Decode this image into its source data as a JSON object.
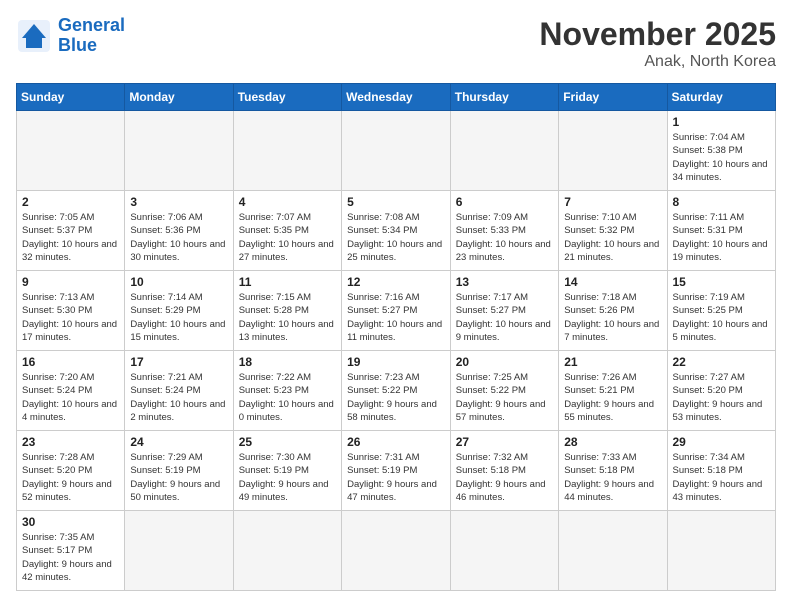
{
  "header": {
    "logo_general": "General",
    "logo_blue": "Blue",
    "month_year": "November 2025",
    "location": "Anak, North Korea"
  },
  "weekdays": [
    "Sunday",
    "Monday",
    "Tuesday",
    "Wednesday",
    "Thursday",
    "Friday",
    "Saturday"
  ],
  "days": {
    "d1": {
      "num": "1",
      "sunrise": "7:04 AM",
      "sunset": "5:38 PM",
      "daylight": "10 hours and 34 minutes."
    },
    "d2": {
      "num": "2",
      "sunrise": "7:05 AM",
      "sunset": "5:37 PM",
      "daylight": "10 hours and 32 minutes."
    },
    "d3": {
      "num": "3",
      "sunrise": "7:06 AM",
      "sunset": "5:36 PM",
      "daylight": "10 hours and 30 minutes."
    },
    "d4": {
      "num": "4",
      "sunrise": "7:07 AM",
      "sunset": "5:35 PM",
      "daylight": "10 hours and 27 minutes."
    },
    "d5": {
      "num": "5",
      "sunrise": "7:08 AM",
      "sunset": "5:34 PM",
      "daylight": "10 hours and 25 minutes."
    },
    "d6": {
      "num": "6",
      "sunrise": "7:09 AM",
      "sunset": "5:33 PM",
      "daylight": "10 hours and 23 minutes."
    },
    "d7": {
      "num": "7",
      "sunrise": "7:10 AM",
      "sunset": "5:32 PM",
      "daylight": "10 hours and 21 minutes."
    },
    "d8": {
      "num": "8",
      "sunrise": "7:11 AM",
      "sunset": "5:31 PM",
      "daylight": "10 hours and 19 minutes."
    },
    "d9": {
      "num": "9",
      "sunrise": "7:13 AM",
      "sunset": "5:30 PM",
      "daylight": "10 hours and 17 minutes."
    },
    "d10": {
      "num": "10",
      "sunrise": "7:14 AM",
      "sunset": "5:29 PM",
      "daylight": "10 hours and 15 minutes."
    },
    "d11": {
      "num": "11",
      "sunrise": "7:15 AM",
      "sunset": "5:28 PM",
      "daylight": "10 hours and 13 minutes."
    },
    "d12": {
      "num": "12",
      "sunrise": "7:16 AM",
      "sunset": "5:27 PM",
      "daylight": "10 hours and 11 minutes."
    },
    "d13": {
      "num": "13",
      "sunrise": "7:17 AM",
      "sunset": "5:27 PM",
      "daylight": "10 hours and 9 minutes."
    },
    "d14": {
      "num": "14",
      "sunrise": "7:18 AM",
      "sunset": "5:26 PM",
      "daylight": "10 hours and 7 minutes."
    },
    "d15": {
      "num": "15",
      "sunrise": "7:19 AM",
      "sunset": "5:25 PM",
      "daylight": "10 hours and 5 minutes."
    },
    "d16": {
      "num": "16",
      "sunrise": "7:20 AM",
      "sunset": "5:24 PM",
      "daylight": "10 hours and 4 minutes."
    },
    "d17": {
      "num": "17",
      "sunrise": "7:21 AM",
      "sunset": "5:24 PM",
      "daylight": "10 hours and 2 minutes."
    },
    "d18": {
      "num": "18",
      "sunrise": "7:22 AM",
      "sunset": "5:23 PM",
      "daylight": "10 hours and 0 minutes."
    },
    "d19": {
      "num": "19",
      "sunrise": "7:23 AM",
      "sunset": "5:22 PM",
      "daylight": "9 hours and 58 minutes."
    },
    "d20": {
      "num": "20",
      "sunrise": "7:25 AM",
      "sunset": "5:22 PM",
      "daylight": "9 hours and 57 minutes."
    },
    "d21": {
      "num": "21",
      "sunrise": "7:26 AM",
      "sunset": "5:21 PM",
      "daylight": "9 hours and 55 minutes."
    },
    "d22": {
      "num": "22",
      "sunrise": "7:27 AM",
      "sunset": "5:20 PM",
      "daylight": "9 hours and 53 minutes."
    },
    "d23": {
      "num": "23",
      "sunrise": "7:28 AM",
      "sunset": "5:20 PM",
      "daylight": "9 hours and 52 minutes."
    },
    "d24": {
      "num": "24",
      "sunrise": "7:29 AM",
      "sunset": "5:19 PM",
      "daylight": "9 hours and 50 minutes."
    },
    "d25": {
      "num": "25",
      "sunrise": "7:30 AM",
      "sunset": "5:19 PM",
      "daylight": "9 hours and 49 minutes."
    },
    "d26": {
      "num": "26",
      "sunrise": "7:31 AM",
      "sunset": "5:19 PM",
      "daylight": "9 hours and 47 minutes."
    },
    "d27": {
      "num": "27",
      "sunrise": "7:32 AM",
      "sunset": "5:18 PM",
      "daylight": "9 hours and 46 minutes."
    },
    "d28": {
      "num": "28",
      "sunrise": "7:33 AM",
      "sunset": "5:18 PM",
      "daylight": "9 hours and 44 minutes."
    },
    "d29": {
      "num": "29",
      "sunrise": "7:34 AM",
      "sunset": "5:18 PM",
      "daylight": "9 hours and 43 minutes."
    },
    "d30": {
      "num": "30",
      "sunrise": "7:35 AM",
      "sunset": "5:17 PM",
      "daylight": "9 hours and 42 minutes."
    }
  }
}
